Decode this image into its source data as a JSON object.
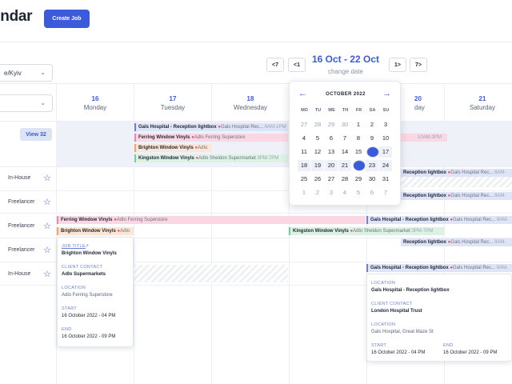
{
  "header": {
    "title": "endar",
    "create_button": "Create Job"
  },
  "filters": {
    "timezone": "e/Kyiv",
    "second": ""
  },
  "range": {
    "prev_week": "<7",
    "prev_day": "<1",
    "label": "16 Oct - 22 Oct",
    "next_day": "1>",
    "next_week": "7>",
    "change": "change date"
  },
  "days": [
    {
      "num": "16",
      "name": "Monday"
    },
    {
      "num": "17",
      "name": "Tuesday"
    },
    {
      "num": "18",
      "name": "Wednesday"
    },
    {
      "num": "20",
      "name": "day"
    },
    {
      "num": "21",
      "name": "Saturday"
    }
  ],
  "view_more": "View 32",
  "rows": [
    {
      "label": "In-House"
    },
    {
      "label": "Freelancer"
    },
    {
      "label": "Freelancer"
    },
    {
      "label": "Freelancer"
    },
    {
      "label": "In-House"
    }
  ],
  "events": {
    "gals1": {
      "title": "Gals Hospital - Reception lightbox",
      "loc": "Gals Hospital Rec...",
      "time": "8AM-1PM"
    },
    "ferring1": {
      "title": "Ferring Window Vinyls",
      "loc": "Adlo Ferring Superstore"
    },
    "time_10_3": "10AM-3PM",
    "brighton1": {
      "title": "Brighton Window Vinyls",
      "loc": "Adlo"
    },
    "kingston1": {
      "title": "Kingston Window Vinyls",
      "loc": "Adlo Sheldon Supermarket",
      "time": "3PM-7PM"
    },
    "gals_r1": {
      "title": "Reception lightbox",
      "loc": "Gals Hospital Rec...",
      "time": "8AM-"
    },
    "gals_r2": {
      "title": "Reception lightbox",
      "loc": "Gals Hospital Rec...",
      "time": "8AM-"
    },
    "ferring2": {
      "title": "Ferring Window Vinyls",
      "loc": "Adlo Ferring Superstore"
    },
    "gals2": {
      "title": "Gals Hospital - Reception lightbox",
      "loc": "Gals Hospital Rec...",
      "time": "8AM-"
    },
    "brighton2": {
      "title": "Brighton Window Vinyls",
      "loc": "Adlo"
    },
    "kingston2": {
      "title": "Kingston Window Vinyls",
      "loc": "Adlo Sheldon Supermarket",
      "time": "3PM-7PM"
    },
    "gals_r3": {
      "title": "Reception lightbox",
      "loc": "Gals Hospital Rec...",
      "time": "8AM-"
    },
    "gals3": {
      "title": "Gals Hospital - Reception lightbox",
      "loc": "Gals Hospital Rec...",
      "time": "8AM-"
    }
  },
  "popup_left": {
    "job_title_label": "JOB TITLE",
    "job_title": "Brighton Window Vinyls",
    "contact_label": "CLIENT CONTACT",
    "contact": "Adlo Supermarkets",
    "location_label": "LOCATION",
    "location": "Adlo Ferring Superstore",
    "start_label": "START",
    "start": "16 October 2022 - 04 PM",
    "end_label": "END",
    "end": "16 October 2022 - 09 PM"
  },
  "popup_right": {
    "location_label": "LOCATION",
    "location_title": "Gals Hospital - Reception lightbox",
    "contact_label": "CLIENT CONTACT",
    "contact": "London Hospital Trust",
    "location2_label": "LOCATION",
    "location": "Gals Hospital, Great Maze St",
    "start_label": "START",
    "start": "16 October 2022 - 04 PM",
    "end_label": "END",
    "end": "16 October 2022 - 09 PM"
  },
  "calendar": {
    "month": "OCTOBER 2022",
    "prev_icon": "arrow-left-icon",
    "next_icon": "arrow-right-icon",
    "weekdays": [
      "MO",
      "TU",
      "WE",
      "TH",
      "FR",
      "SA",
      "SU"
    ],
    "weeks": [
      [
        "27",
        "28",
        "29",
        "30",
        "1",
        "2",
        "3"
      ],
      [
        "4",
        "5",
        "6",
        "7",
        "8",
        "9",
        "10"
      ],
      [
        "11",
        "12",
        "13",
        "14",
        "15",
        "16",
        "17"
      ],
      [
        "18",
        "19",
        "20",
        "21",
        "22",
        "23",
        "24"
      ],
      [
        "25",
        "26",
        "27",
        "28",
        "29",
        "30",
        "31"
      ],
      [
        "1",
        "2",
        "3",
        "4",
        "5",
        "6",
        "7"
      ]
    ],
    "selected_start": "16",
    "selected_end": "22"
  },
  "colors": {
    "accent": "#3b5bdb",
    "pink": "#fbd7e3",
    "orange": "#fde6d4",
    "green": "#dcf3e4",
    "lavender": "#dfe4f7"
  }
}
